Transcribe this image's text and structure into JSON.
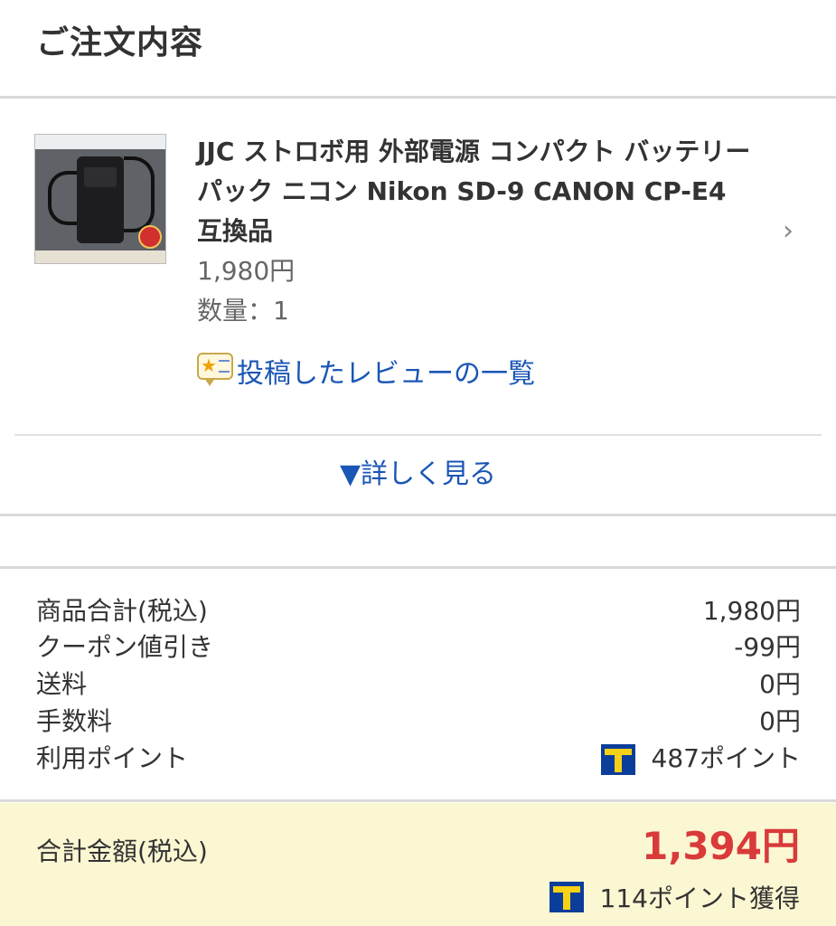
{
  "header": {
    "title": "ご注文内容"
  },
  "item": {
    "title": "JJC ストロボ用 外部電源 コンパクト バッテリーパック ニコン Nikon SD-9 CANON CP-E4 互換品",
    "price": "1,980円",
    "quantity": "数量：1",
    "review_link": "投稿したレビューの一覧",
    "chevron": "›"
  },
  "more": {
    "label": "▼詳しく見る"
  },
  "summary": {
    "rows": [
      {
        "label": "商品合計(税込)",
        "value": "1,980円"
      },
      {
        "label": "クーポン値引き",
        "value": "-99円"
      },
      {
        "label": "送料",
        "value": "0円"
      },
      {
        "label": "手数料",
        "value": "0円"
      },
      {
        "label": "利用ポイント",
        "value": "487ポイント"
      }
    ]
  },
  "total": {
    "label": "合計金額(税込)",
    "value": "1,394円",
    "earn": "114ポイント獲得"
  },
  "colors": {
    "link": "#1a56b5",
    "total_red": "#d93a3a",
    "total_bg": "#fbf7d2",
    "tpoint_blue": "#0b3e9a",
    "tpoint_yellow": "#f7d117"
  }
}
